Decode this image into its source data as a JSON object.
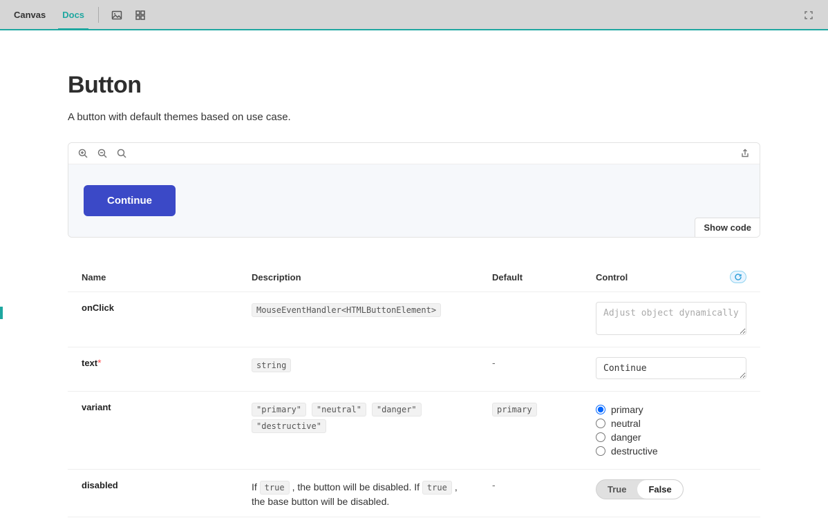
{
  "toolbar": {
    "tabs": [
      {
        "label": "Canvas",
        "active": false
      },
      {
        "label": "Docs",
        "active": true
      }
    ]
  },
  "page": {
    "title": "Button",
    "subtitle": "A button with default themes based on use case."
  },
  "preview": {
    "button_label": "Continue",
    "show_code": "Show code"
  },
  "table": {
    "headers": {
      "name": "Name",
      "description": "Description",
      "default": "Default",
      "control": "Control"
    },
    "rows": {
      "onClick": {
        "name": "onClick",
        "type": "MouseEventHandler<HTMLButtonElement>",
        "control_placeholder": "Adjust object dynamically"
      },
      "text": {
        "name": "text",
        "required": true,
        "type": "string",
        "default": "-",
        "control_value": "Continue"
      },
      "variant": {
        "name": "variant",
        "options": [
          "\"primary\"",
          "\"neutral\"",
          "\"danger\"",
          "\"destructive\""
        ],
        "default": "primary",
        "radio_options": [
          "primary",
          "neutral",
          "danger",
          "destructive"
        ],
        "selected": "primary"
      },
      "disabled": {
        "name": "disabled",
        "desc_pre": "If ",
        "desc_code1": "true",
        "desc_mid": ", the button will be disabled. If ",
        "desc_code2": "true",
        "desc_post": ", the base button will be disabled.",
        "default": "-",
        "toggle": {
          "true": "True",
          "false": "False",
          "value": false
        }
      }
    }
  }
}
